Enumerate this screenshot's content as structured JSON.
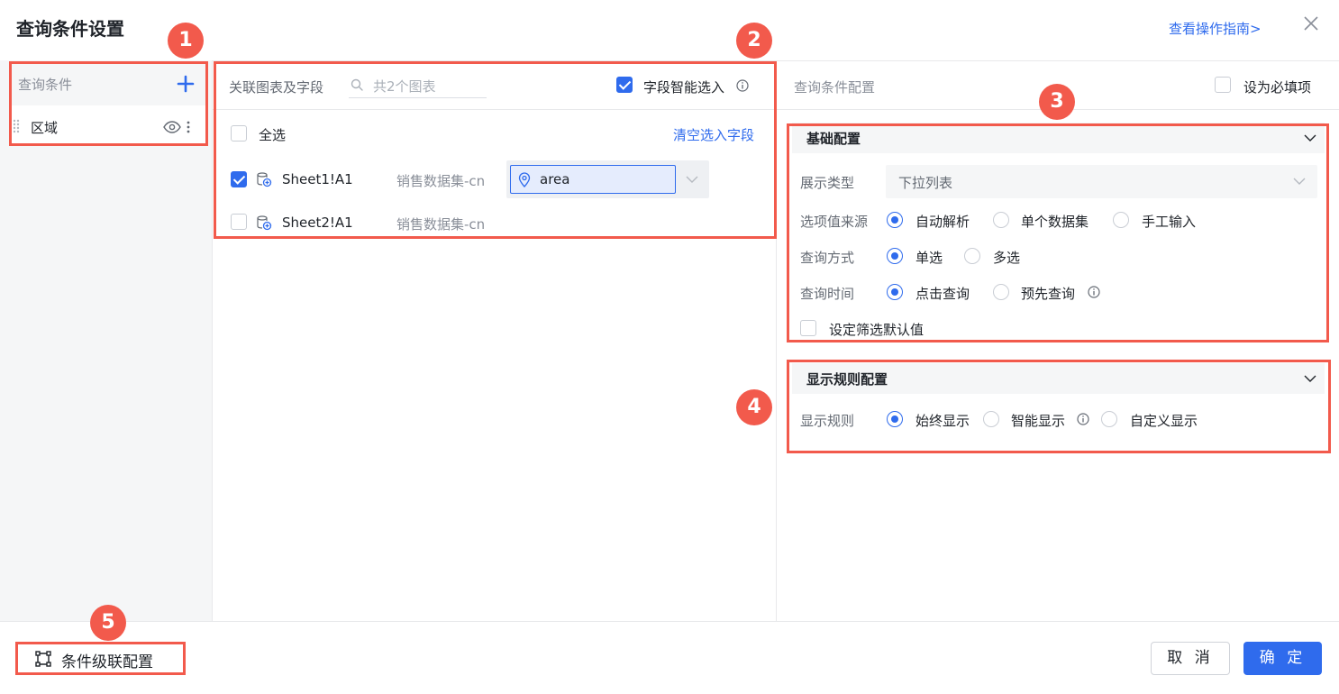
{
  "dialog": {
    "title": "查询条件设置",
    "guide_link": "查看操作指南>"
  },
  "left": {
    "header": "查询条件",
    "items": [
      {
        "label": "区域"
      }
    ]
  },
  "middle": {
    "title": "关联图表及字段",
    "search_placeholder": "共2个图表",
    "smart_select_label": "字段智能选入",
    "smart_select_checked": true,
    "select_all_label": "全选",
    "clear_link": "清空选入字段",
    "rows": [
      {
        "name": "Sheet1!A1",
        "dataset": "销售数据集-cn",
        "checked": true,
        "field": "area"
      },
      {
        "name": "Sheet2!A1",
        "dataset": "销售数据集-cn",
        "checked": false
      }
    ]
  },
  "right": {
    "title": "查询条件配置",
    "required_label": "设为必填项",
    "basic": {
      "title": "基础配置",
      "display_type_label": "展示类型",
      "display_type_value": "下拉列表",
      "source_label": "选项值来源",
      "source_options": [
        "自动解析",
        "单个数据集",
        "手工输入"
      ],
      "source_selected": "自动解析",
      "mode_label": "查询方式",
      "mode_options": [
        "单选",
        "多选"
      ],
      "mode_selected": "单选",
      "time_label": "查询时间",
      "time_options": [
        "点击查询",
        "预先查询"
      ],
      "time_selected": "点击查询",
      "default_label": "设定筛选默认值"
    },
    "display": {
      "title": "显示规则配置",
      "rule_label": "显示规则",
      "rule_options": [
        "始终显示",
        "智能显示",
        "自定义显示"
      ],
      "rule_selected": "始终显示"
    }
  },
  "footer": {
    "cascade_label": "条件级联配置",
    "cancel": "取 消",
    "ok": "确 定"
  },
  "annotations": [
    "1",
    "2",
    "3",
    "4",
    "5"
  ],
  "colors": {
    "accent": "#2f6bed",
    "annotation": "#f25a4c"
  }
}
